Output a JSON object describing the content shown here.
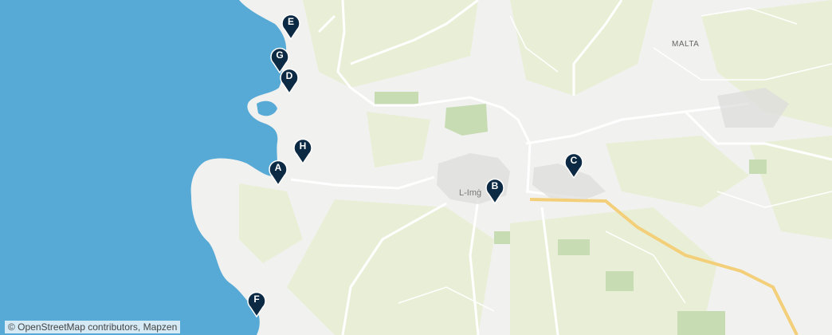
{
  "map": {
    "country_label": "MALTA",
    "town_label": "L-Imġ",
    "attribution": "© OpenStreetMap contributors, Mapzen",
    "colors": {
      "sea": "#58aad6",
      "land": "#f1f1ef",
      "green": "#e9efd6",
      "park": "#c8dcb4",
      "road": "#ffffff",
      "motorway": "#f3cf7a",
      "pin": "#0d2a44",
      "pin_text": "#ffffff"
    }
  },
  "markers": [
    {
      "letter": "E"
    },
    {
      "letter": "G"
    },
    {
      "letter": "D"
    },
    {
      "letter": "H"
    },
    {
      "letter": "A"
    },
    {
      "letter": "B"
    },
    {
      "letter": "C"
    },
    {
      "letter": "F"
    }
  ]
}
